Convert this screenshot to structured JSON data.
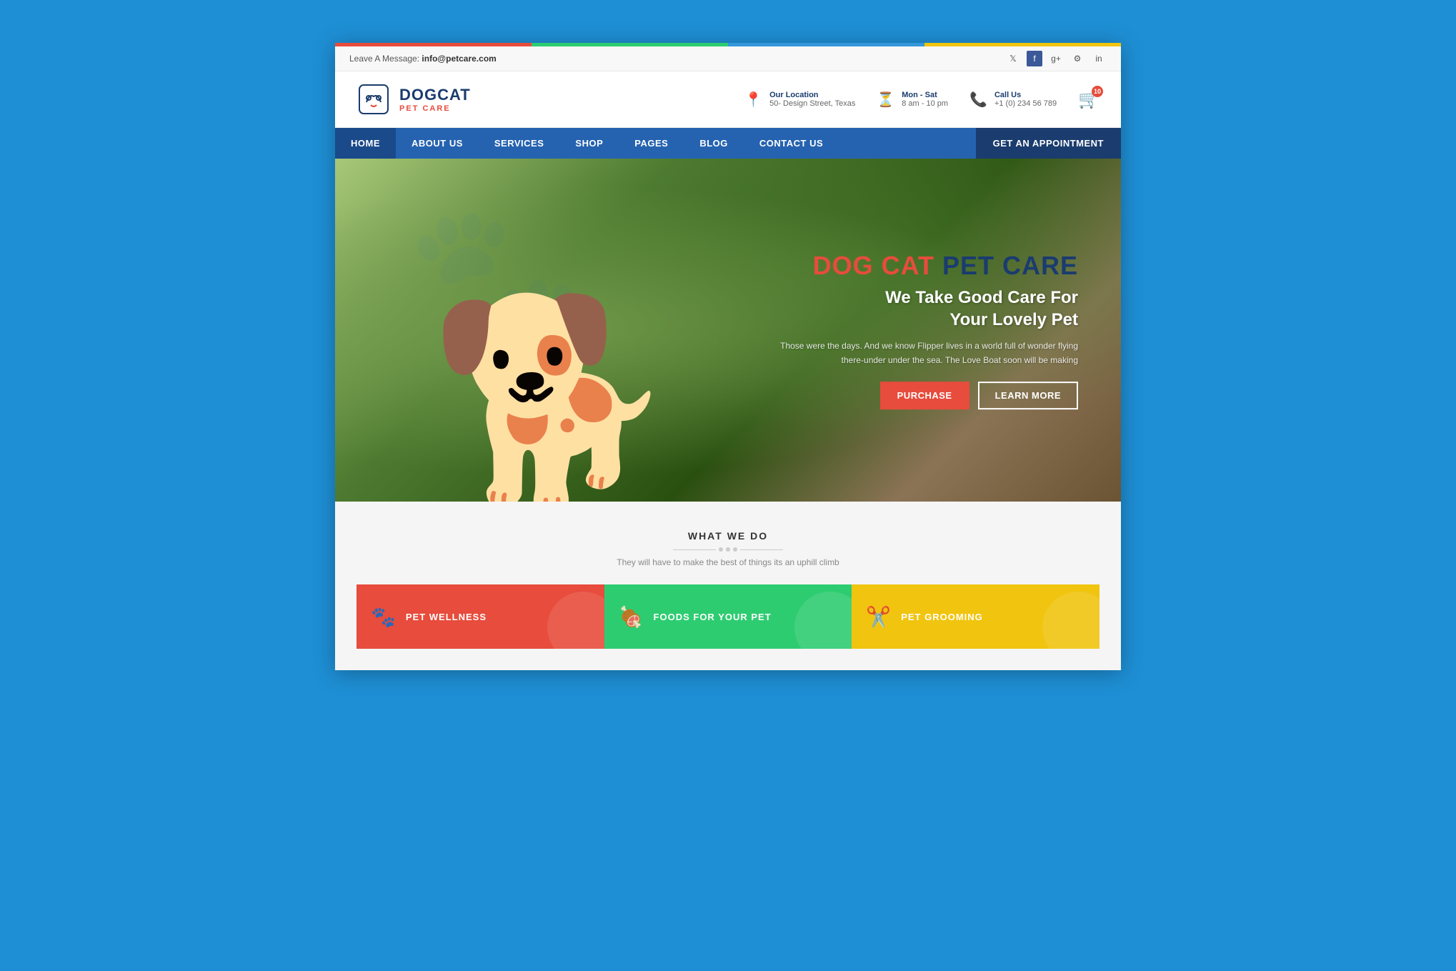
{
  "browser": {
    "background": "#1e8fd5"
  },
  "topbar": {
    "message_label": "Leave A Message:",
    "message_email": "info@petcare.com",
    "social_icons": [
      "twitter",
      "facebook",
      "google-plus",
      "settings",
      "linkedin"
    ]
  },
  "header": {
    "logo": {
      "brand": "DOGCAT",
      "sub": "PET CARE"
    },
    "info_items": [
      {
        "icon": "📍",
        "label": "Our Location",
        "value": "50- Design Street, Texas"
      },
      {
        "icon": "⏳",
        "label": "Mon - Sat",
        "value": "8 am - 10 pm"
      },
      {
        "icon": "📞",
        "label": "Call Us",
        "value": "+1 (0) 234 56 789"
      }
    ],
    "cart_count": "10"
  },
  "nav": {
    "items": [
      {
        "label": "HOME",
        "active": true
      },
      {
        "label": "ABOUT US",
        "active": false
      },
      {
        "label": "SERVICES",
        "active": false
      },
      {
        "label": "SHOP",
        "active": false
      },
      {
        "label": "PAGES",
        "active": false
      },
      {
        "label": "BLOG",
        "active": false
      },
      {
        "label": "CONTACT US",
        "active": false
      }
    ],
    "cta": "GET AN APPOINTMENT"
  },
  "hero": {
    "title_part1": "DOG CAT ",
    "title_part2": "PET CARE",
    "subtitle_line1": "We Take Good Care For",
    "subtitle_line2": "Your Lovely Pet",
    "description": "Those were the days. And we know Flipper lives in a world full of wonder flying there-under under the sea. The Love Boat soon will be making",
    "btn_purchase": "PURCHASE",
    "btn_learn": "LEARN MORE",
    "dog_emoji": "🐕"
  },
  "what_we_do": {
    "section_title": "WHAT WE DO",
    "section_desc": "They will have to make the best of things its an uphill climb"
  },
  "services": [
    {
      "label": "PET WELLNESS",
      "icon": "🐾",
      "color": "red"
    },
    {
      "label": "FOODS FOR YOUR PET",
      "icon": "🍖",
      "color": "green"
    },
    {
      "label": "PET GROOMING",
      "icon": "✂️",
      "color": "yellow"
    }
  ]
}
